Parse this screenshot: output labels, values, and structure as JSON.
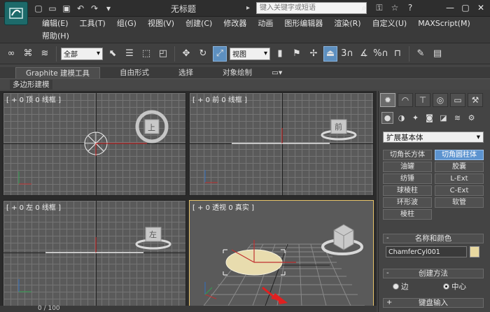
{
  "titlebar": {
    "title": "无标题",
    "search_placeholder": "键入关键字或短语",
    "quick_access_icons": [
      "new-file-icon",
      "open-folder-icon",
      "save-icon",
      "undo-icon",
      "redo-icon",
      "dropdown-icon"
    ],
    "tool_icons": [
      "binoculars-icon",
      "key-icon",
      "star-icon",
      "help-icon"
    ],
    "window_controls": [
      "minimize-icon",
      "maximize-icon",
      "close-icon"
    ]
  },
  "menu": {
    "row1": [
      "编辑(E)",
      "工具(T)",
      "组(G)",
      "视图(V)",
      "创建(C)",
      "修改器",
      "动画",
      "图形编辑器",
      "渲染(R)",
      "自定义(U)",
      "MAXScript(M)"
    ],
    "row2": [
      "帮助(H)"
    ]
  },
  "toolbar": {
    "selection_filter": "全部",
    "reference_coord": "视图",
    "snap_label": "3",
    "percent_label": "%"
  },
  "ribbon": {
    "tabs": [
      "Graphite 建模工具",
      "自由形式",
      "选择",
      "对象绘制"
    ],
    "active_tab": "Graphite 建模工具",
    "sub_tab": "多边形建模"
  },
  "viewports": {
    "top": "[ + 0 顶 0 线框 ]",
    "front": "[ + 0 前 0 线框 ]",
    "left": "[ + 0 左 0 线框 ]",
    "perspective": "[ + 0 透视 0 真实 ]",
    "viewcube_top": "上",
    "viewcube_front": "前",
    "viewcube_left": "左"
  },
  "command_panel": {
    "category": "扩展基本体",
    "primitives": [
      {
        "label": "切角长方体",
        "active": false
      },
      {
        "label": "切角圆柱体",
        "active": true
      },
      {
        "label": "油罐",
        "active": false
      },
      {
        "label": "胶囊",
        "active": false
      },
      {
        "label": "纺锤",
        "active": false
      },
      {
        "label": "L-Ext",
        "active": false
      },
      {
        "label": "球棱柱",
        "active": false
      },
      {
        "label": "C-Ext",
        "active": false
      },
      {
        "label": "环形波",
        "active": false
      },
      {
        "label": "软管",
        "active": false
      },
      {
        "label": "棱柱",
        "active": false
      }
    ],
    "rollout_name_color": "名称和颜色",
    "object_name": "ChamferCyl001",
    "object_color": "#e8d8a0",
    "rollout_creation": "创建方法",
    "radio_edge": "边",
    "radio_center": "中心",
    "rollout_keyboard": "键盘输入",
    "pm": "-",
    "pm_plus": "+"
  },
  "timeline": {
    "frame": "0 / 100"
  }
}
